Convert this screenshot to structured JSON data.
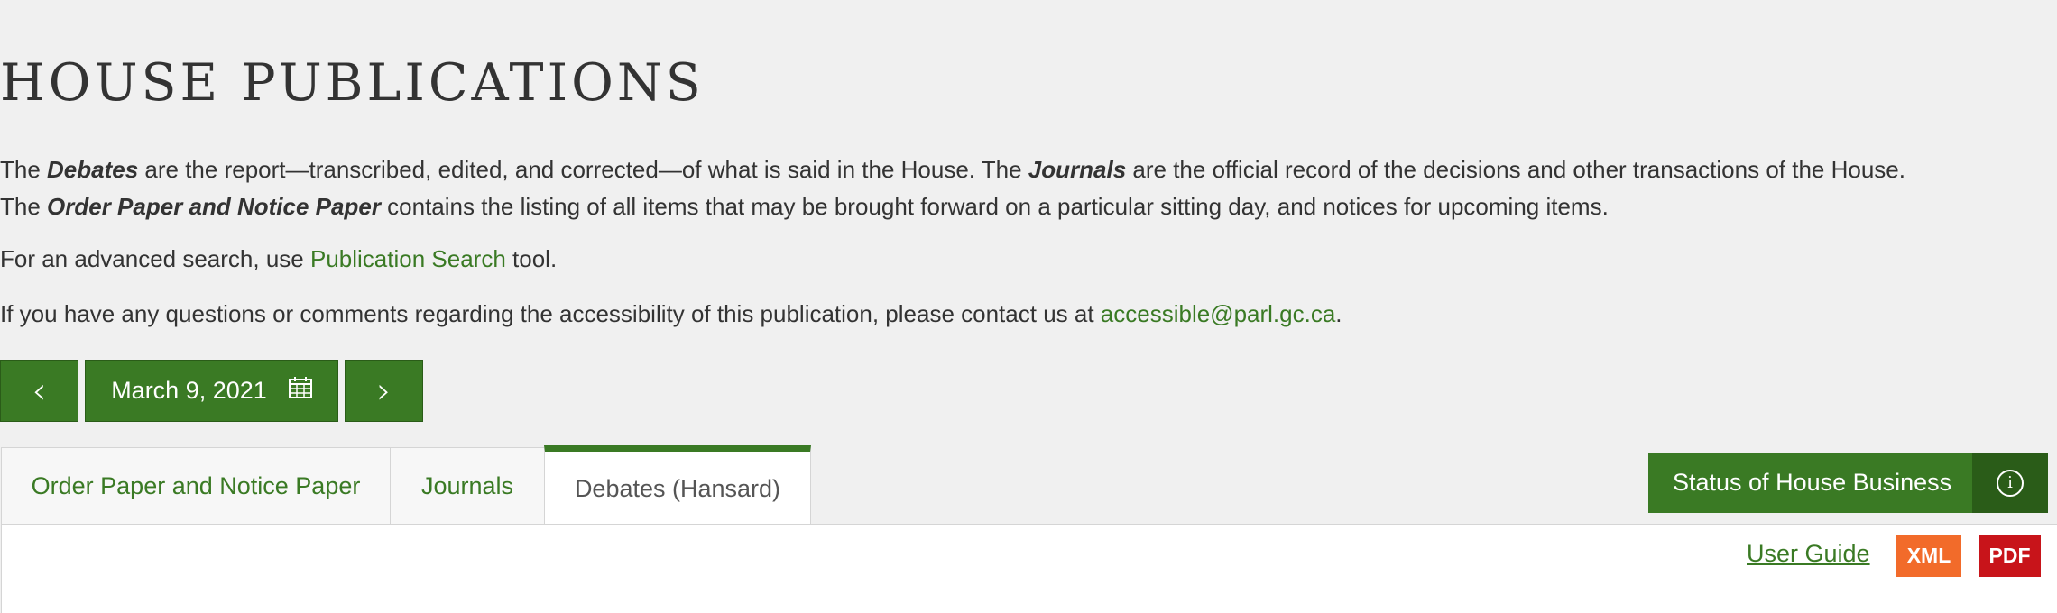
{
  "page": {
    "title": "HOUSE PUBLICATIONS"
  },
  "intro": {
    "l1_p1": "The ",
    "l1_debates": "Debates",
    "l1_p2": " are the report—transcribed, edited, and corrected—of what is said in the House. The ",
    "l1_journals": "Journals",
    "l1_p3": " are the official record of the decisions and other transactions of the House.",
    "l2_p1": "The ",
    "l2_order": "Order Paper and Notice Paper",
    "l2_p2": " contains the listing of all items that may be brought forward on a particular sitting day, and notices for upcoming items."
  },
  "advanced": {
    "p1": "For an advanced search, use ",
    "link": "Publication Search",
    "p2": " tool."
  },
  "contact": {
    "p1": "If you have any questions or comments regarding the accessibility of this publication, please contact us at ",
    "email": "accessible@parl.gc.ca",
    "p2": "."
  },
  "date_nav": {
    "prev_icon": "chevron-left-icon",
    "date": "March 9, 2021",
    "calendar_icon": "calendar-icon",
    "next_icon": "chevron-right-icon"
  },
  "tabs": [
    {
      "label": "Order Paper and Notice Paper",
      "active": false
    },
    {
      "label": "Journals",
      "active": false
    },
    {
      "label": "Debates (Hansard)",
      "active": true
    }
  ],
  "status_button": {
    "label": "Status of House Business",
    "icon": "info-icon"
  },
  "toolbar": {
    "user_guide": "User Guide",
    "xml": "XML",
    "pdf": "PDF"
  },
  "colors": {
    "accent_green": "#3a7a24",
    "xml_orange": "#f26b2a",
    "pdf_red": "#c8141a",
    "background": "#f0f0f0"
  }
}
